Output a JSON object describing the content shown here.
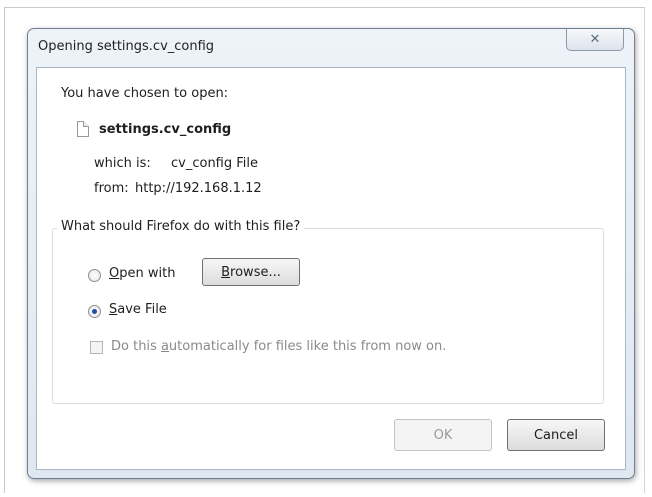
{
  "dialog": {
    "title": "Opening settings.cv_config",
    "close_glyph": "✕"
  },
  "file": {
    "intro": "You have chosen to open:",
    "icon": "document-icon",
    "name": "settings.cv_config",
    "which_label": "which is:",
    "type": "cv_config File",
    "from_label": "from:",
    "source": "http://192.168.1.12"
  },
  "action_group": {
    "legend": "What should Firefox do with this file?",
    "open_with": {
      "access_key": "O",
      "rest": "pen with",
      "selected": false
    },
    "browse": {
      "access_key": "B",
      "rest": "rowse..."
    },
    "save_file": {
      "access_key": "S",
      "rest": "ave File",
      "selected": true
    },
    "auto": {
      "prefix": "Do this ",
      "access_key": "a",
      "rest": "utomatically for files like this from now on.",
      "checked": false,
      "enabled": false
    }
  },
  "buttons": {
    "ok": "OK",
    "cancel": "Cancel"
  }
}
